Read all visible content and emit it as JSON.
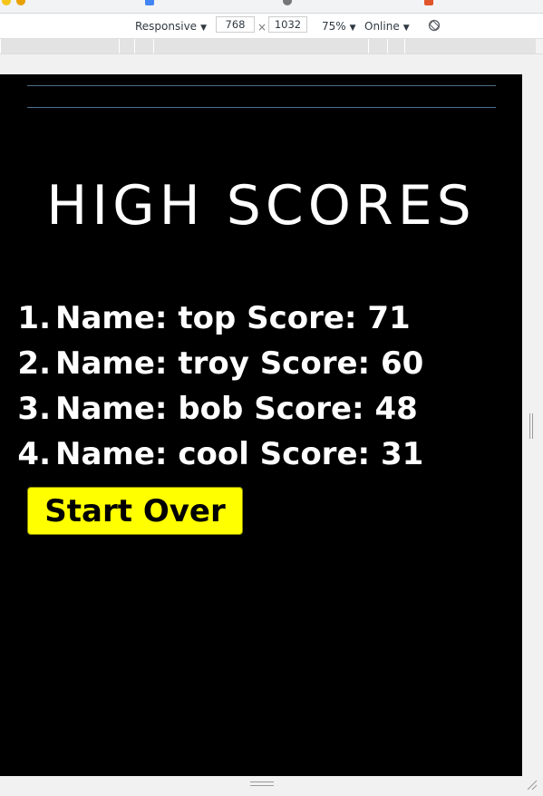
{
  "devtools": {
    "device": "Responsive",
    "width": "768",
    "times": "×",
    "height": "1032",
    "zoom": "75%",
    "network": "Online"
  },
  "game": {
    "title": "HIGH SCORES",
    "scores": [
      {
        "rank": "1.",
        "text": "Name: top Score: 71"
      },
      {
        "rank": "2.",
        "text": "Name: troy Score: 60"
      },
      {
        "rank": "3.",
        "text": "Name: bob Score: 48"
      },
      {
        "rank": "4.",
        "text": "Name: cool Score: 31"
      }
    ],
    "start_over_label": "Start Over"
  },
  "colors": {
    "background": "#000000",
    "text": "#ffffff",
    "button": "#ffff00",
    "divider": "#4b6f8a"
  },
  "icons": [
    "caret-down-icon",
    "rotate-icon",
    "resize-handle-icon"
  ]
}
